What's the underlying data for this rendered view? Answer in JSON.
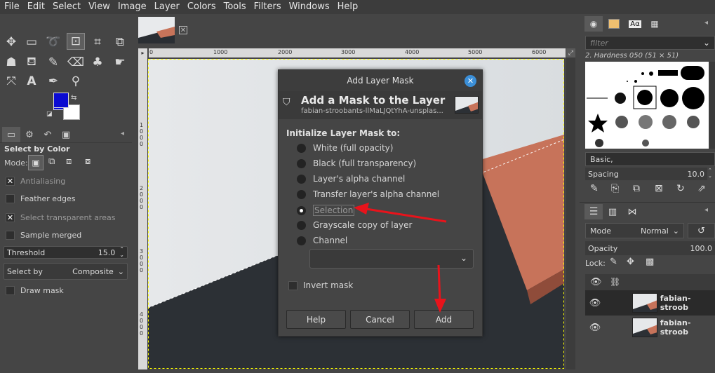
{
  "menubar": {
    "items": [
      "File",
      "Edit",
      "Select",
      "View",
      "Image",
      "Layer",
      "Colors",
      "Tools",
      "Filters",
      "Windows",
      "Help"
    ]
  },
  "tool_options": {
    "title": "Select by Color",
    "mode_label": "Mode:",
    "antialiasing": "Antialiasing",
    "feather_edges": "Feather edges",
    "select_transparent": "Select transparent areas",
    "sample_merged": "Sample merged",
    "threshold_label": "Threshold",
    "threshold_value": "15.0",
    "select_by_label": "Select by",
    "select_by_value": "Composite",
    "draw_mask": "Draw mask"
  },
  "ruler": {
    "top": [
      "0",
      "1000",
      "2000",
      "3000",
      "4000",
      "5000",
      "6000"
    ],
    "left": [
      "1000",
      "2000",
      "3000",
      "4000"
    ]
  },
  "dialog": {
    "window_title": "Add Layer Mask",
    "header_title": "Add a Mask to the Layer",
    "header_subtitle": "fabian-stroobants-llMaLJQtYhA-unsplas...",
    "section_label": "Initialize Layer Mask to:",
    "options": [
      "White (full opacity)",
      "Black (full transparency)",
      "Layer's alpha channel",
      "Transfer layer's alpha channel",
      "Selection",
      "Grayscale copy of layer",
      "Channel"
    ],
    "selected_index": 4,
    "invert_mask": "Invert mask",
    "buttons": {
      "help": "Help",
      "cancel": "Cancel",
      "add": "Add"
    }
  },
  "brushes": {
    "filter_placeholder": "filter",
    "brush_name": "2. Hardness 050 (51 × 51)",
    "tag": "Basic,",
    "spacing_label": "Spacing",
    "spacing_value": "10.0"
  },
  "layers": {
    "mode_label": "Mode",
    "mode_value": "Normal",
    "opacity_label": "Opacity",
    "opacity_value": "100.0",
    "lock_label": "Lock:",
    "items": [
      {
        "name": "fabian-stroob"
      },
      {
        "name": "fabian-stroob"
      }
    ]
  },
  "colors": {
    "foreground": "#0b0bd1",
    "background": "#ffffff",
    "annotation_arrow": "#e8131b",
    "accent": "#3b8fd8"
  }
}
